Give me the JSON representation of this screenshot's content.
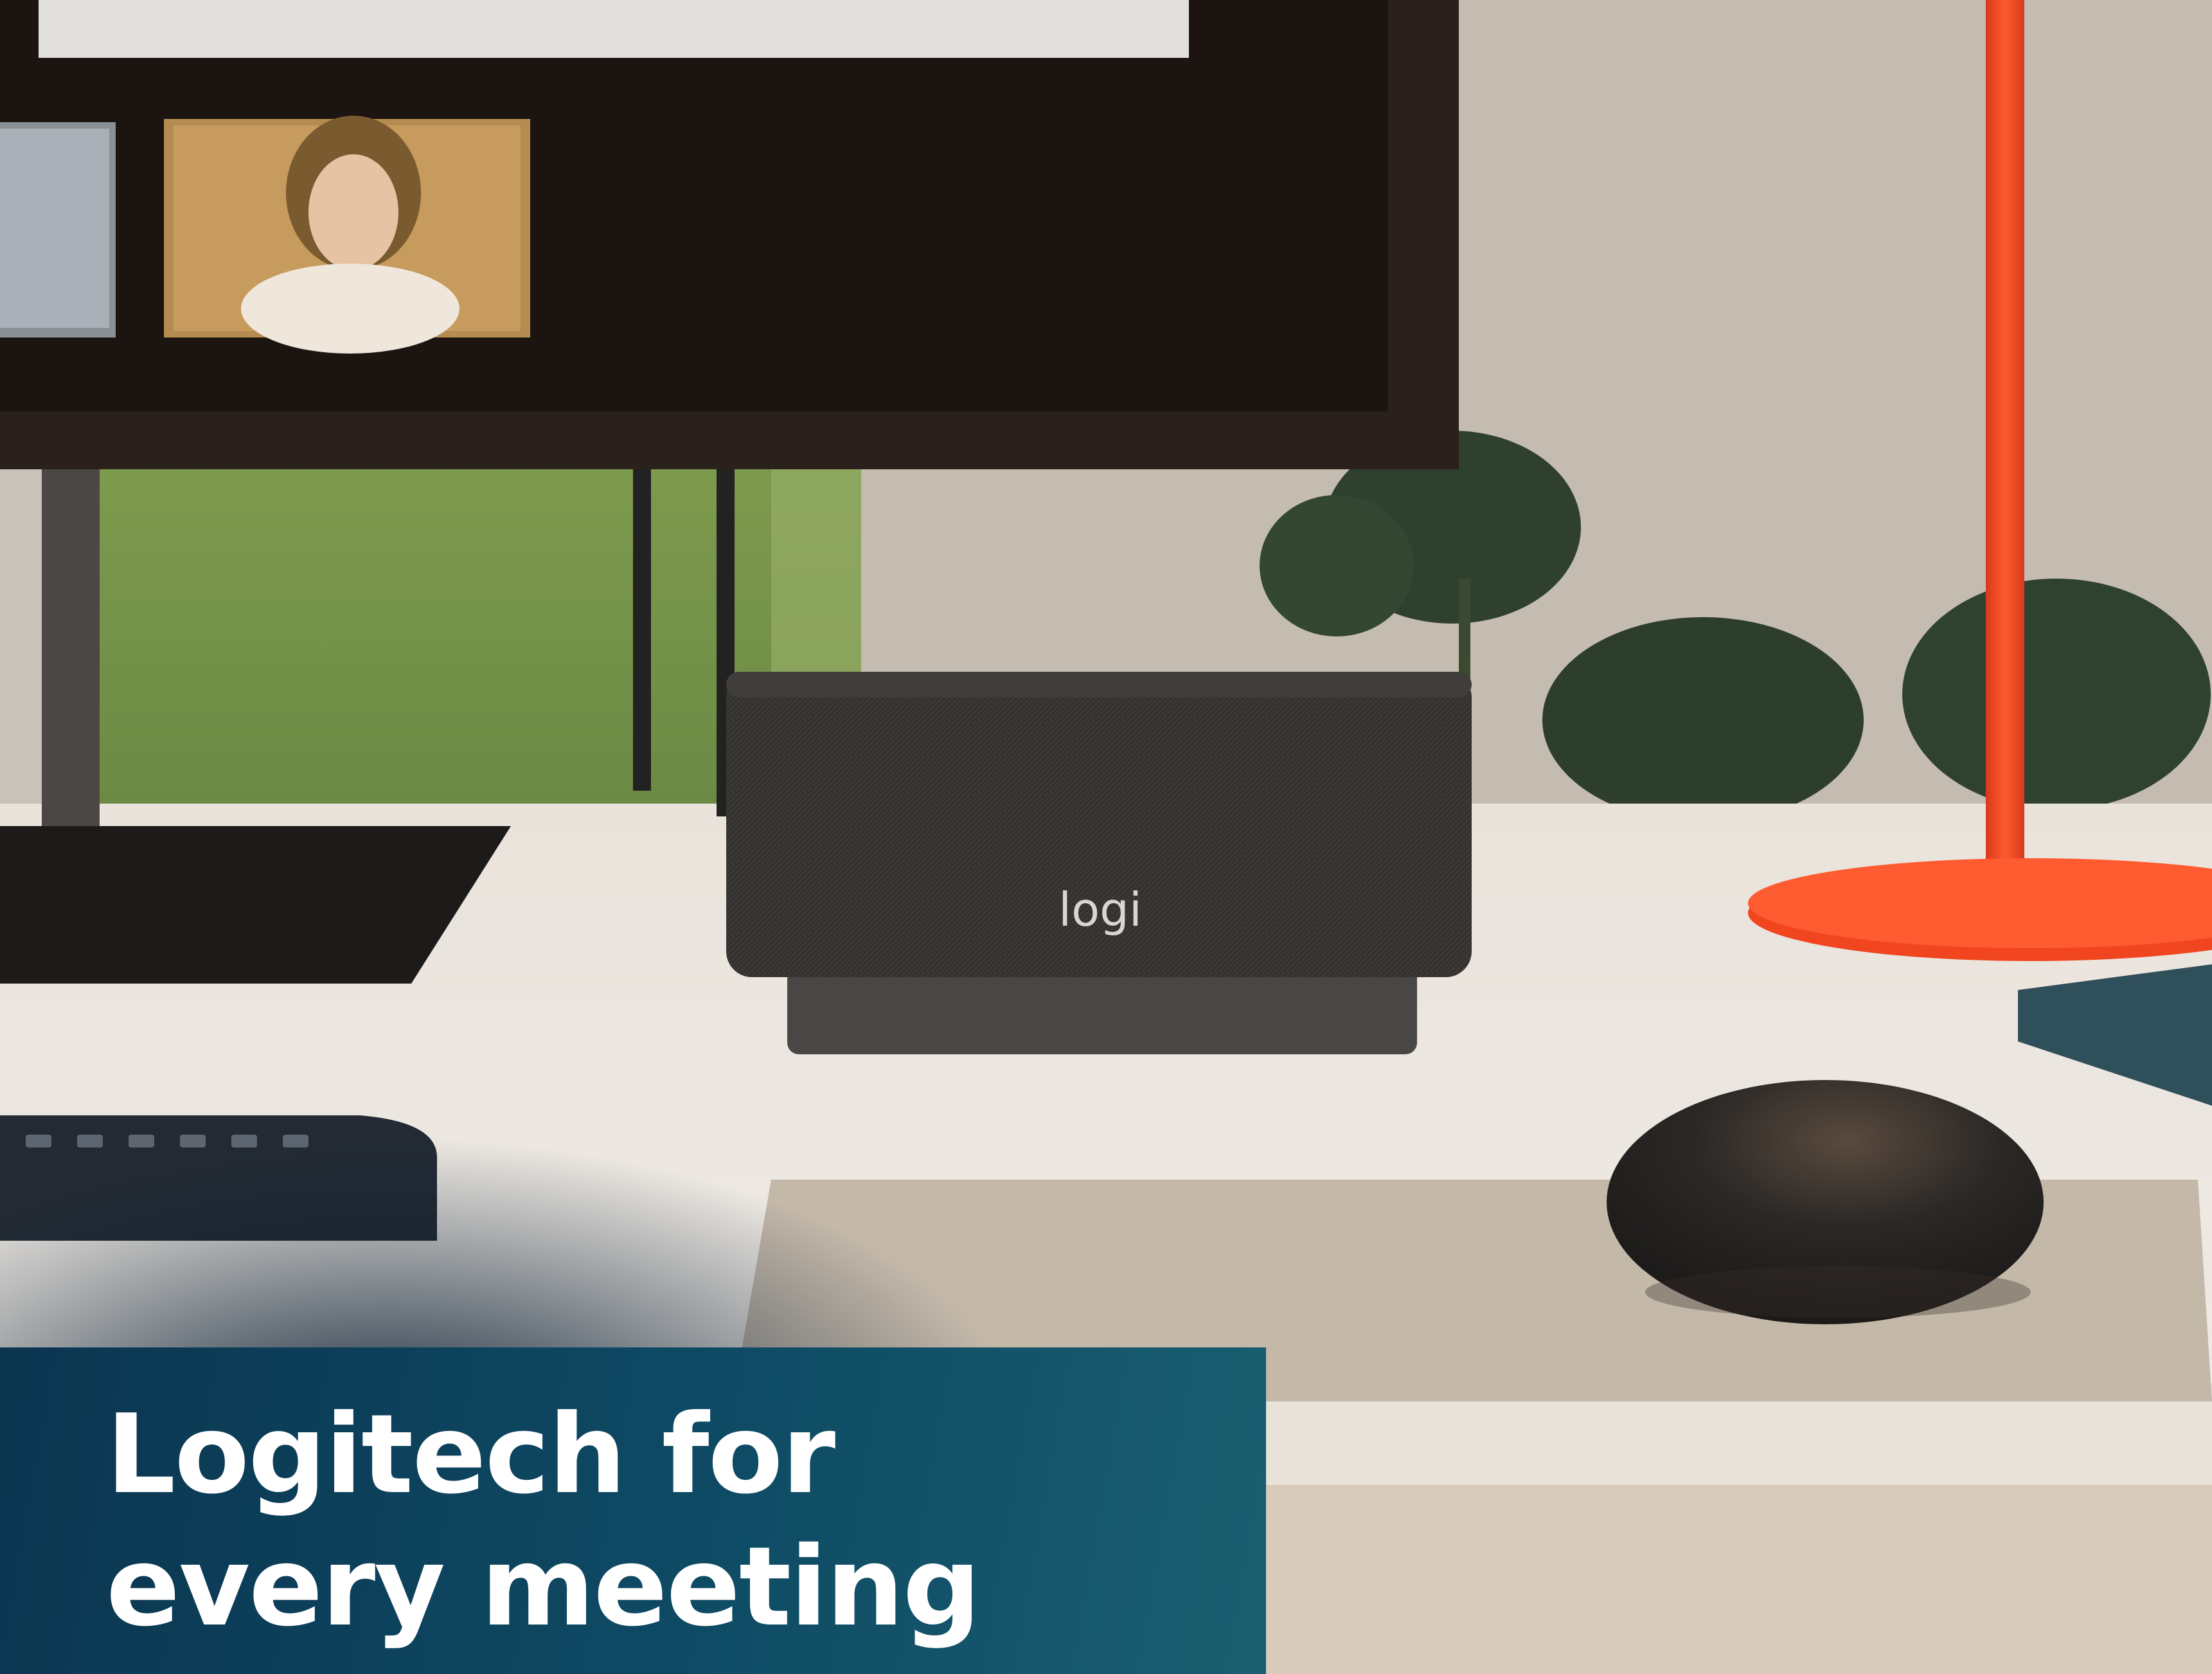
{
  "product_logo": "logi",
  "headline": {
    "line1": "Logitech for",
    "line2": "every meeting"
  },
  "colors": {
    "panel": "#0e4a64",
    "lamp_accent": "#f0451f",
    "headline_text": "#ffffff"
  }
}
